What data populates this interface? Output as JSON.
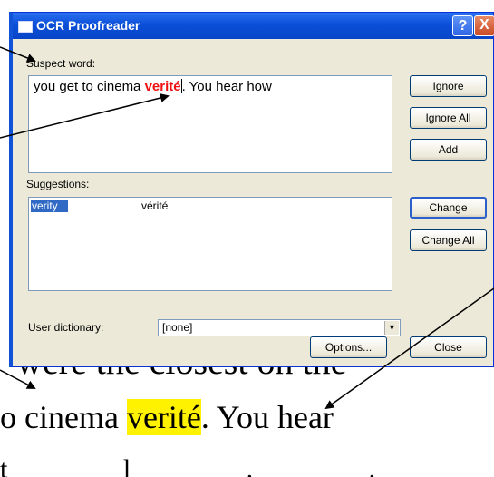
{
  "window": {
    "title": "OCR Proofreader",
    "help": "?",
    "close": "X"
  },
  "suspect": {
    "label": "Suspect word:",
    "text_before": "you get to cinema ",
    "word": "verité",
    "text_after": ". You hear how"
  },
  "suggestions": {
    "label": "Suggestions:",
    "selected": "verity",
    "alternate": "vérité"
  },
  "buttons": {
    "ignore": "Ignore",
    "ignore_all": "Ignore All",
    "add": "Add",
    "change": "Change",
    "change_all": "Change All",
    "options": "Options...",
    "close": "Close"
  },
  "dictionary": {
    "label": "User dictionary:",
    "value": "[none]"
  },
  "document": {
    "line1": "were  the closest on the",
    "line2_before": "o cinema ",
    "line2_word": "verité",
    "line2_after": ". You hear",
    "line3": "t  l  .  ."
  }
}
